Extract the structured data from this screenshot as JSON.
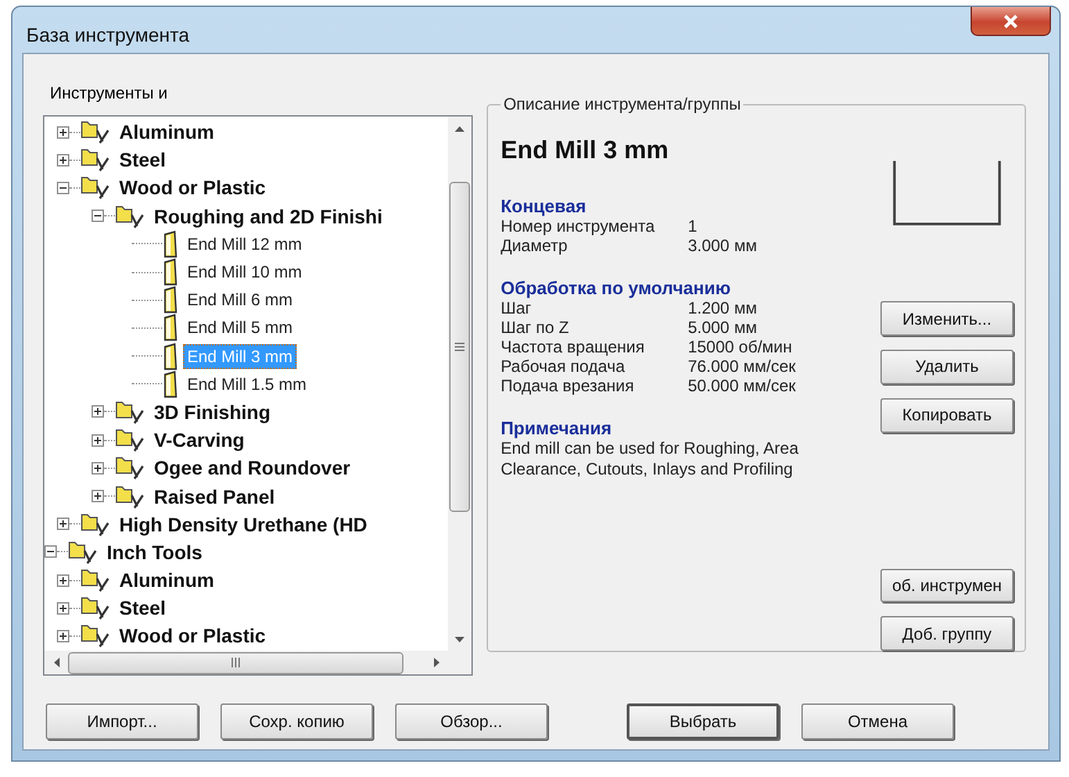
{
  "window": {
    "title": "База инструмента"
  },
  "tree": {
    "label": "Инструменты и",
    "items": [
      {
        "children": [
          {
            "label": "Aluminum",
            "kind": "group",
            "expanded": false,
            "selected": false
          },
          {
            "label": "Steel",
            "kind": "group",
            "expanded": false,
            "selected": false
          },
          {
            "label": "Wood or Plastic",
            "kind": "group",
            "expanded": true,
            "selected": false,
            "children": [
              {
                "label": "Roughing and 2D Finishi",
                "kind": "group",
                "expanded": true,
                "selected": false,
                "children": [
                  {
                    "label": "End Mill 12 mm",
                    "kind": "tool",
                    "selected": false
                  },
                  {
                    "label": "End Mill 10 mm",
                    "kind": "tool",
                    "selected": false
                  },
                  {
                    "label": "End Mill 6 mm",
                    "kind": "tool",
                    "selected": false
                  },
                  {
                    "label": "End Mill 5 mm",
                    "kind": "tool",
                    "selected": false
                  },
                  {
                    "label": "End Mill 3 mm",
                    "kind": "tool",
                    "selected": true
                  },
                  {
                    "label": "End Mill 1.5 mm",
                    "kind": "tool",
                    "selected": false
                  }
                ]
              },
              {
                "label": "3D Finishing",
                "kind": "group",
                "expanded": false,
                "selected": false
              },
              {
                "label": "V-Carving",
                "kind": "group",
                "expanded": false,
                "selected": false
              },
              {
                "label": "Ogee and Roundover",
                "kind": "group",
                "expanded": false,
                "selected": false
              },
              {
                "label": "Raised Panel",
                "kind": "group",
                "expanded": false,
                "selected": false
              }
            ]
          },
          {
            "label": "High Density Urethane (HD",
            "kind": "group",
            "expanded": false,
            "selected": false
          }
        ]
      },
      {
        "label": "Inch Tools",
        "kind": "group",
        "expanded": true,
        "selected": false,
        "children": [
          {
            "label": "Aluminum",
            "kind": "group",
            "expanded": false,
            "selected": false
          },
          {
            "label": "Steel",
            "kind": "group",
            "expanded": false,
            "selected": false
          },
          {
            "label": "Wood or Plastic",
            "kind": "group",
            "expanded": false,
            "selected": false
          }
        ]
      }
    ]
  },
  "details": {
    "legend": "Описание инструмента/группы",
    "title": "End Mill 3 mm",
    "sections": [
      {
        "kind": "table",
        "heading": "Концевая",
        "rows": [
          {
            "label": "Номер инструмента",
            "value": "1"
          },
          {
            "label": "Диаметр",
            "value": "3.000 мм"
          }
        ]
      },
      {
        "kind": "table",
        "heading": "Обработка по умолчанию",
        "rows": [
          {
            "label": "Шаг",
            "value": "1.200 мм"
          },
          {
            "label": "Шаг по Z",
            "value": "5.000 мм"
          },
          {
            "label": "Частота вращения",
            "value": "15000 об/мин"
          },
          {
            "label": "Рабочая подача",
            "value": "76.000 мм/сек"
          },
          {
            "label": "Подача врезания",
            "value": "50.000 мм/сек"
          }
        ]
      },
      {
        "kind": "text",
        "heading": "Примечания",
        "text": "End mill can be used for Roughing, Area Clearance, Cutouts, Inlays and Profiling"
      }
    ]
  },
  "side_buttons": [
    "Изменить...",
    "Удалить",
    "Копировать"
  ],
  "add_buttons": [
    "об. инструмен",
    "Доб. группу"
  ],
  "bottom_buttons": [
    {
      "label": "Импорт...",
      "default": false
    },
    {
      "label": "Сохр. копию",
      "default": false
    },
    {
      "label": "Обзор...",
      "default": false
    },
    {
      "label": "Выбрать",
      "default": true
    },
    {
      "label": "Отмена",
      "default": false
    }
  ]
}
